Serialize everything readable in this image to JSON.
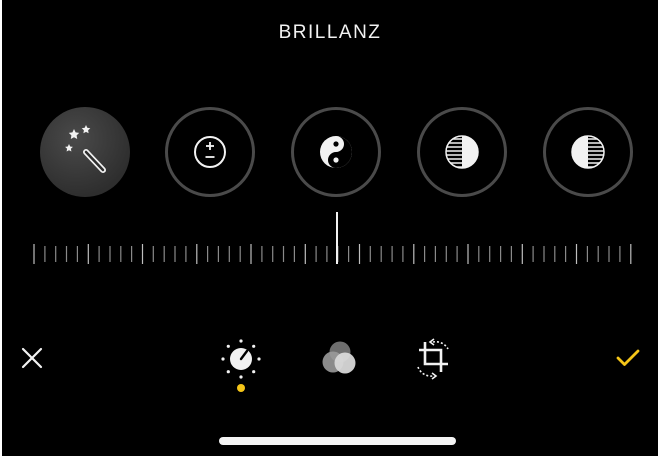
{
  "header": {
    "title": "BRILLANZ"
  },
  "adjustments": {
    "selected": "auto-enhance",
    "items": [
      {
        "id": "auto-enhance",
        "icon": "magic-wand-icon"
      },
      {
        "id": "exposure",
        "icon": "plus-minus-icon"
      },
      {
        "id": "brilliance",
        "icon": "yin-yang-icon"
      },
      {
        "id": "highlights",
        "icon": "half-striped-circle-icon"
      },
      {
        "id": "shadows",
        "icon": "half-striped-circle-right-icon"
      }
    ]
  },
  "slider": {
    "value_position": 0.5
  },
  "toolbar": {
    "cancel_icon": "close-icon",
    "confirm_icon": "checkmark-icon",
    "modes": [
      {
        "id": "adjust",
        "icon": "adjust-dial-icon",
        "active": true
      },
      {
        "id": "filters",
        "icon": "filters-circles-icon",
        "active": false
      },
      {
        "id": "crop",
        "icon": "crop-rotate-icon",
        "active": false
      }
    ]
  },
  "colors": {
    "background": "#000000",
    "accent": "#f5c518",
    "ring": "#4a4a4a",
    "text": "#f2f2f2"
  }
}
